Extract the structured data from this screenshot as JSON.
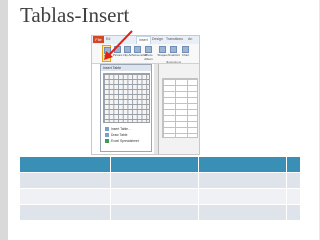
{
  "slide": {
    "title": "Tablas-Insert"
  },
  "screenshot": {
    "tabs": [
      {
        "label": "File",
        "active": false
      },
      {
        "label": "Ed",
        "active": false
      },
      {
        "label": "Insert",
        "active": true
      },
      {
        "label": "Design",
        "active": false
      },
      {
        "label": "Transitions",
        "active": false
      },
      {
        "label": "An",
        "active": false
      }
    ],
    "ribbon_buttons": [
      {
        "label": "Table",
        "icon": "table-icon"
      },
      {
        "label": "Picture",
        "icon": "picture-icon"
      },
      {
        "label": "Clip Art",
        "icon": "clipart-icon"
      },
      {
        "label": "Screenshot",
        "icon": "screenshot-icon"
      },
      {
        "label": "Photo Album",
        "icon": "photo-album-icon"
      },
      {
        "label": "Shapes",
        "icon": "shapes-icon"
      },
      {
        "label": "SmartArt",
        "icon": "smartart-icon"
      },
      {
        "label": "Chart",
        "icon": "chart-icon"
      }
    ],
    "ribbon_group_label": "Illustrations",
    "dropdown": {
      "title": "Insert Table",
      "menu_items": [
        "Insert Table...",
        "Draw Table",
        "Excel Spreadsheet"
      ]
    }
  },
  "colors": {
    "arrow": "#e0201b",
    "table_header": "#3a8fb7",
    "table_row_odd": "#dfe3ea",
    "table_row_even": "#eff1f5"
  },
  "table": {
    "columns": 4,
    "rows": 4
  }
}
